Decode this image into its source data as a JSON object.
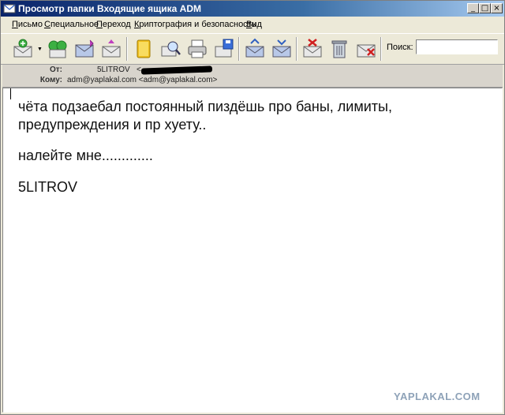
{
  "window": {
    "title": "Просмотр папки Входящие ящика ADM",
    "controls": {
      "minimize": "_",
      "maximize": "□",
      "close": "×"
    }
  },
  "menu": [
    {
      "label": "Письмо",
      "u": "П",
      "rest": "исьмо"
    },
    {
      "label": "Специальное",
      "u": "С",
      "rest": "пециальное"
    },
    {
      "label": "Переход",
      "u": "П",
      "rest": "ереход"
    },
    {
      "label": "Криптография и безопасность",
      "u": "К",
      "rest": "риптография и безопасность"
    },
    {
      "label": "Вид",
      "u": "В",
      "rest": "ид"
    }
  ],
  "toolbar": {
    "buttons": [
      "new-mail-icon",
      "forward-icon",
      "reply-icon",
      "reply-all-icon",
      "address-book-icon",
      "find-icon",
      "print-icon",
      "save-icon",
      "move-icon",
      "copy-icon",
      "delete-mark-icon",
      "trash-icon",
      "delete-icon"
    ],
    "search_label": "Поиск:",
    "search_value": ""
  },
  "headers": {
    "from_label": "От:",
    "from_name": "5LITROV",
    "from_open": "<",
    "to_label": "Кому:",
    "to_value": "adm@yaplakal.com <adm@yaplakal.com>"
  },
  "message": {
    "line1": "чёта подзаебал постоянный пиздёшь про баны, лимиты,",
    "line2": "предупреждения и пр хуету..",
    "line3": "налейте мне.............",
    "line4": "5LITROV"
  },
  "watermark": "YAPLAKAL.COM",
  "colors": {
    "title_start": "#0a246a",
    "title_end": "#a6caf0",
    "chrome": "#ece9d8",
    "body": "#ffffff"
  }
}
